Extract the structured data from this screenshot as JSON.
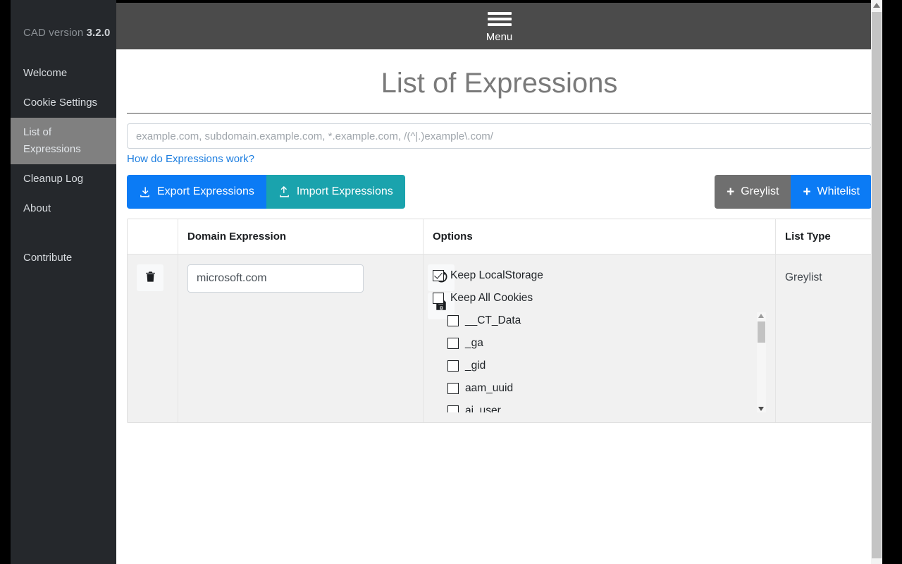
{
  "sidebar": {
    "version_prefix": "CAD version ",
    "version_number": "3.2.0",
    "items": [
      {
        "label": "Welcome",
        "active": false
      },
      {
        "label": "Cookie Settings",
        "active": false
      },
      {
        "label": "List of\nExpressions",
        "active": true
      },
      {
        "label": "Cleanup Log",
        "active": false
      },
      {
        "label": "About",
        "active": false
      },
      {
        "label": "Contribute",
        "active": false
      }
    ]
  },
  "topbar": {
    "menu_label": "Menu",
    "menu_icon": "hamburger-icon"
  },
  "main": {
    "page_title": "List of Expressions",
    "expression_input_value": "",
    "expression_input_placeholder": "example.com, subdomain.example.com, *.example.com, /(^|.)example\\.com/",
    "help_link": "How do Expressions work?"
  },
  "toolbar": {
    "export_label": "Export Expressions",
    "export_icon": "download-icon",
    "import_label": "Import Expressions",
    "import_icon": "upload-icon",
    "greylist_label": "Greylist",
    "greylist_icon": "plus-icon",
    "whitelist_label": "Whitelist",
    "whitelist_icon": "plus-icon"
  },
  "table": {
    "headers": {
      "delete": "",
      "domain": "Domain Expression",
      "options": "Options",
      "list_type": "List Type"
    },
    "rows": [
      {
        "delete_icon": "trash-icon",
        "cancel_icon": "ban-icon",
        "save_icon": "floppy-disk-icon",
        "domain_value": "microsoft.com",
        "options": [
          {
            "label": "Keep LocalStorage",
            "checked": true,
            "indent": false
          },
          {
            "label": "Keep All Cookies",
            "checked": false,
            "indent": false
          }
        ],
        "cookies": [
          {
            "label": "__CT_Data",
            "checked": false
          },
          {
            "label": "_ga",
            "checked": false
          },
          {
            "label": "_gid",
            "checked": false
          },
          {
            "label": "aam_uuid",
            "checked": false
          },
          {
            "label": "ai_user",
            "checked": false
          }
        ],
        "list_type": "Greylist"
      }
    ]
  },
  "colors": {
    "accent_blue": "#0b7bf5",
    "teal": "#1aa3ad",
    "grey_button": "#6f6f6f",
    "sidebar_bg": "#25282c",
    "active_nav_bg": "#808080",
    "active_nav_border": "#1e9bf0",
    "topbar_bg": "#4b4b4b",
    "link_blue": "#1f7fe0"
  }
}
